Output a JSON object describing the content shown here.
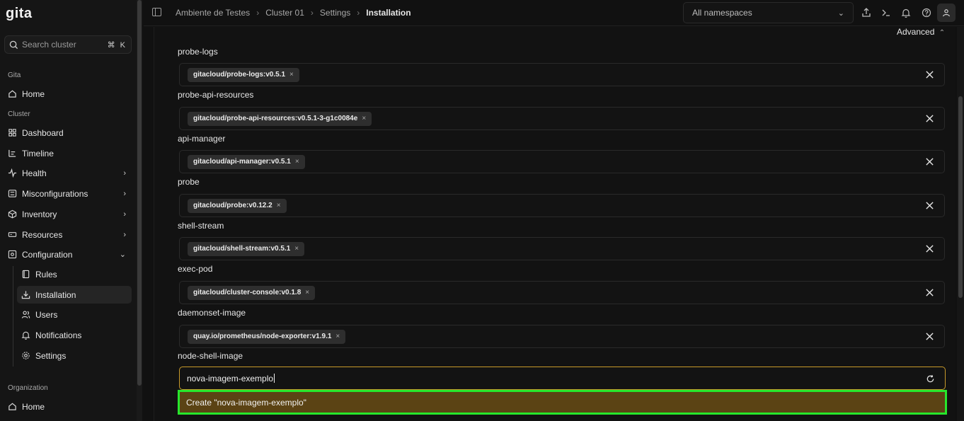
{
  "app": {
    "logo": "gita"
  },
  "sidebar": {
    "search_placeholder": "Search cluster",
    "search_shortcut": "⌘ K",
    "sections": {
      "gita": "Gita",
      "cluster": "Cluster",
      "organization": "Organization"
    },
    "items": {
      "home": "Home",
      "dashboard": "Dashboard",
      "timeline": "Timeline",
      "health": "Health",
      "misconfigurations": "Misconfigurations",
      "inventory": "Inventory",
      "resources": "Resources",
      "configuration": "Configuration",
      "rules": "Rules",
      "installation": "Installation",
      "users": "Users",
      "notifications": "Notifications",
      "settings": "Settings",
      "org_home": "Home"
    }
  },
  "header": {
    "breadcrumb": [
      "Ambiente de Testes",
      "Cluster 01",
      "Settings",
      "Installation"
    ],
    "namespace_select": "All namespaces"
  },
  "main": {
    "advanced_label": "Advanced",
    "fields": [
      {
        "label": "probe-logs",
        "tag": "gitacloud/probe-logs:v0.5.1"
      },
      {
        "label": "probe-api-resources",
        "tag": "gitacloud/probe-api-resources:v0.5.1-3-g1c0084e"
      },
      {
        "label": "api-manager",
        "tag": "gitacloud/api-manager:v0.5.1"
      },
      {
        "label": "probe",
        "tag": "gitacloud/probe:v0.12.2"
      },
      {
        "label": "shell-stream",
        "tag": "gitacloud/shell-stream:v0.5.1"
      },
      {
        "label": "exec-pod",
        "tag": "gitacloud/cluster-console:v0.1.8"
      },
      {
        "label": "daemonset-image",
        "tag": "quay.io/prometheus/node-exporter:v1.9.1"
      }
    ],
    "node_shell": {
      "label": "node-shell-image",
      "input_value": "nova-imagem-exemplo",
      "create_option": "Create \"nova-imagem-exemplo\""
    }
  },
  "colors": {
    "accent_border": "#c89a2a",
    "highlight": "#27e62c",
    "option_bg": "#5b4314"
  }
}
